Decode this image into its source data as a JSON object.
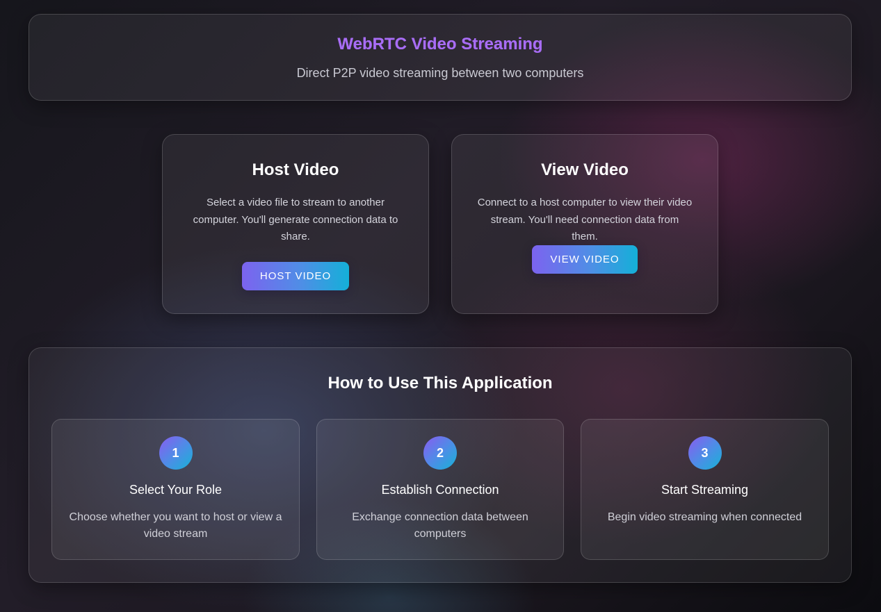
{
  "header": {
    "title": "WebRTC Video Streaming",
    "subtitle": "Direct P2P video streaming between two computers"
  },
  "roles": {
    "host": {
      "title": "Host Video",
      "description": "Select a video file to stream to another computer. You'll generate connection data to share.",
      "button_label": "HOST VIDEO"
    },
    "view": {
      "title": "View Video",
      "description": "Connect to a host computer to view their video stream. You'll need connection data from them.",
      "button_label": "VIEW VIDEO"
    }
  },
  "howto": {
    "title": "How to Use This Application",
    "steps": [
      {
        "number": "1",
        "title": "Select Your Role",
        "description": "Choose whether you want to host or view a video stream"
      },
      {
        "number": "2",
        "title": "Establish Connection",
        "description": "Exchange connection data between computers"
      },
      {
        "number": "3",
        "title": "Start Streaming",
        "description": "Begin video streaming when connected"
      }
    ]
  },
  "colors": {
    "accent_purple": "#a86df5",
    "button_gradient_start": "#7c63ef",
    "button_gradient_end": "#14b0d8"
  }
}
